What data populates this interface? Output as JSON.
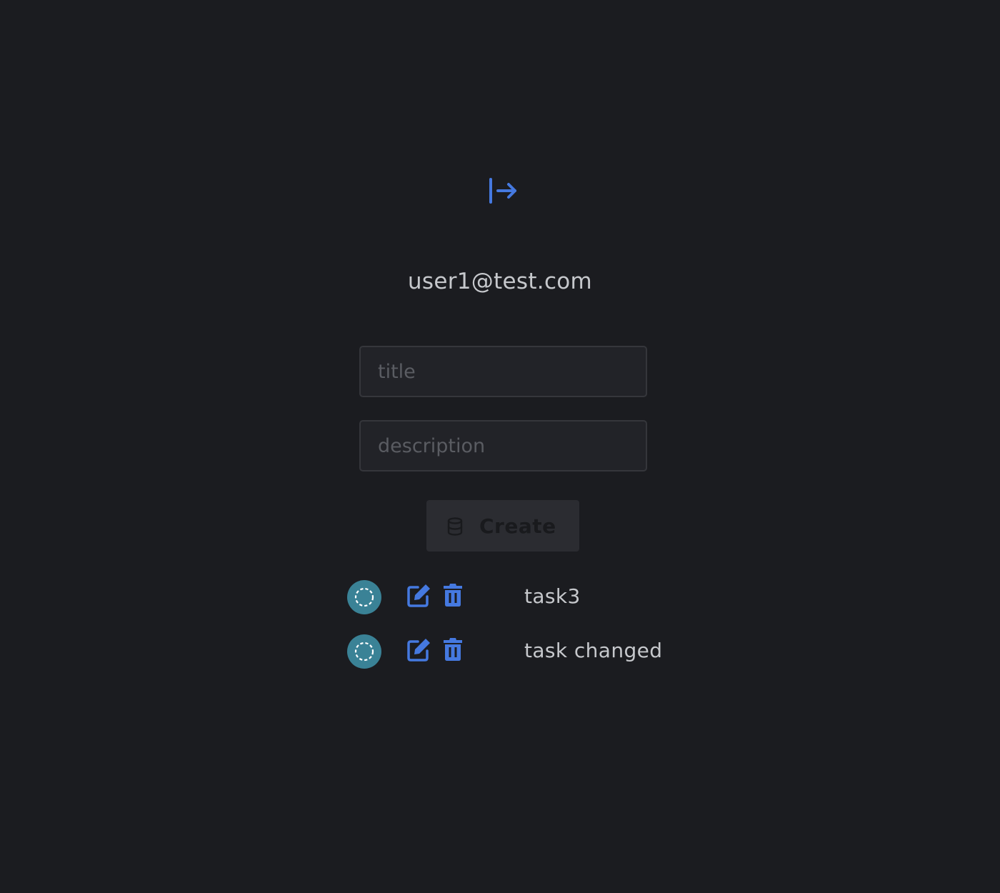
{
  "header": {
    "logout_icon": "logout-icon",
    "user_email": "user1@test.com"
  },
  "form": {
    "title_placeholder": "title",
    "title_value": "",
    "description_placeholder": "description",
    "description_value": "",
    "create_label": "Create",
    "create_icon": "database-icon",
    "create_disabled": true
  },
  "tasks": [
    {
      "title": "task3",
      "status_icon": "dashed-circle-icon",
      "edit_icon": "edit-icon",
      "delete_icon": "trash-icon"
    },
    {
      "title": "task changed",
      "status_icon": "dashed-circle-icon",
      "edit_icon": "edit-icon",
      "delete_icon": "trash-icon"
    }
  ],
  "colors": {
    "background": "#1b1c20",
    "accent": "#4579e0",
    "status_toggle": "#3a8296",
    "text": "#c6c8cc",
    "input_bg": "#222328",
    "button_disabled_bg": "#2b2c31"
  }
}
